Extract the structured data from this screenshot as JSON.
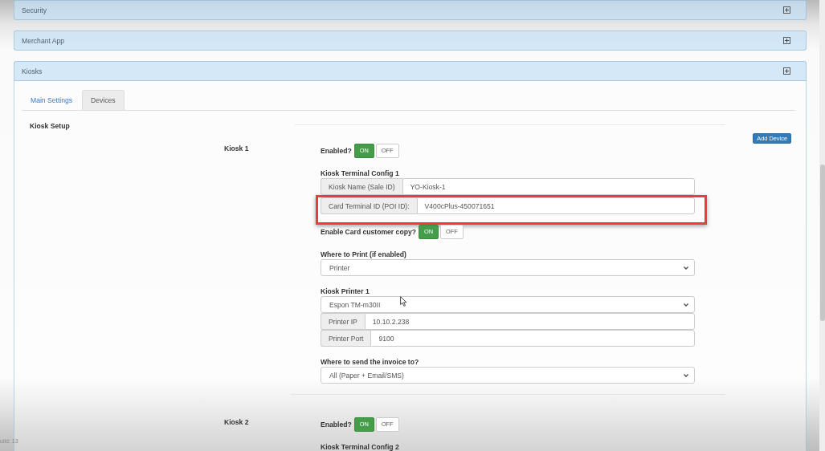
{
  "collapsed_panels": [
    {
      "title": "Security"
    },
    {
      "title": "Merchant App"
    }
  ],
  "kiosks_panel": {
    "title": "Kiosks",
    "tabs": [
      {
        "label": "Main Settings",
        "selected": false
      },
      {
        "label": "Devices",
        "selected": true
      }
    ],
    "section_title": "Kiosk Setup",
    "add_button": "Add Device",
    "kiosks": [
      {
        "name": "Kiosk 1",
        "rows": [
          {
            "kind": "toggle",
            "label": "Enabled?",
            "on": true,
            "on_text": "ON",
            "off_text": "OFF",
            "highlighted": false
          },
          {
            "kind": "heading",
            "text": "Kiosk Terminal Config 1",
            "highlighted": false
          },
          {
            "kind": "input",
            "label": "Kiosk Name (Sale ID)",
            "value": "YO-Kiosk-1",
            "highlighted": false
          },
          {
            "kind": "input",
            "label": "Card Terminal ID (POI ID):",
            "value": "V400cPlus-450071651",
            "highlighted": true
          },
          {
            "kind": "toggle",
            "label": "Enable Card customer copy?",
            "on": true,
            "on_text": "ON",
            "off_text": "OFF",
            "highlighted": false
          },
          {
            "kind": "heading",
            "text": "Where to Print (if enabled)",
            "highlighted": false
          },
          {
            "kind": "select",
            "value": "Printer",
            "highlighted": false
          },
          {
            "kind": "heading",
            "text": "Kiosk Printer 1",
            "highlighted": false
          },
          {
            "kind": "select",
            "value": "Espon TM-m30II",
            "highlighted": false
          },
          {
            "kind": "input",
            "label": "Printer IP",
            "value": "10.10.2.238",
            "highlighted": false
          },
          {
            "kind": "input",
            "label": "Printer Port",
            "value": "9100",
            "highlighted": false
          },
          {
            "kind": "heading",
            "text": "Where to send the invoice to?",
            "highlighted": false
          },
          {
            "kind": "select",
            "value": "All (Paper + Email/SMS)",
            "highlighted": false
          }
        ]
      },
      {
        "name": "Kiosk 2",
        "rows": [
          {
            "kind": "toggle",
            "label": "Enabled?",
            "on": true,
            "on_text": "ON",
            "off_text": "OFF",
            "highlighted": false
          },
          {
            "kind": "heading",
            "text": "Kiosk Terminal Config 2",
            "highlighted": false
          }
        ]
      }
    ]
  },
  "footer": {
    "build": "uild: 13"
  }
}
